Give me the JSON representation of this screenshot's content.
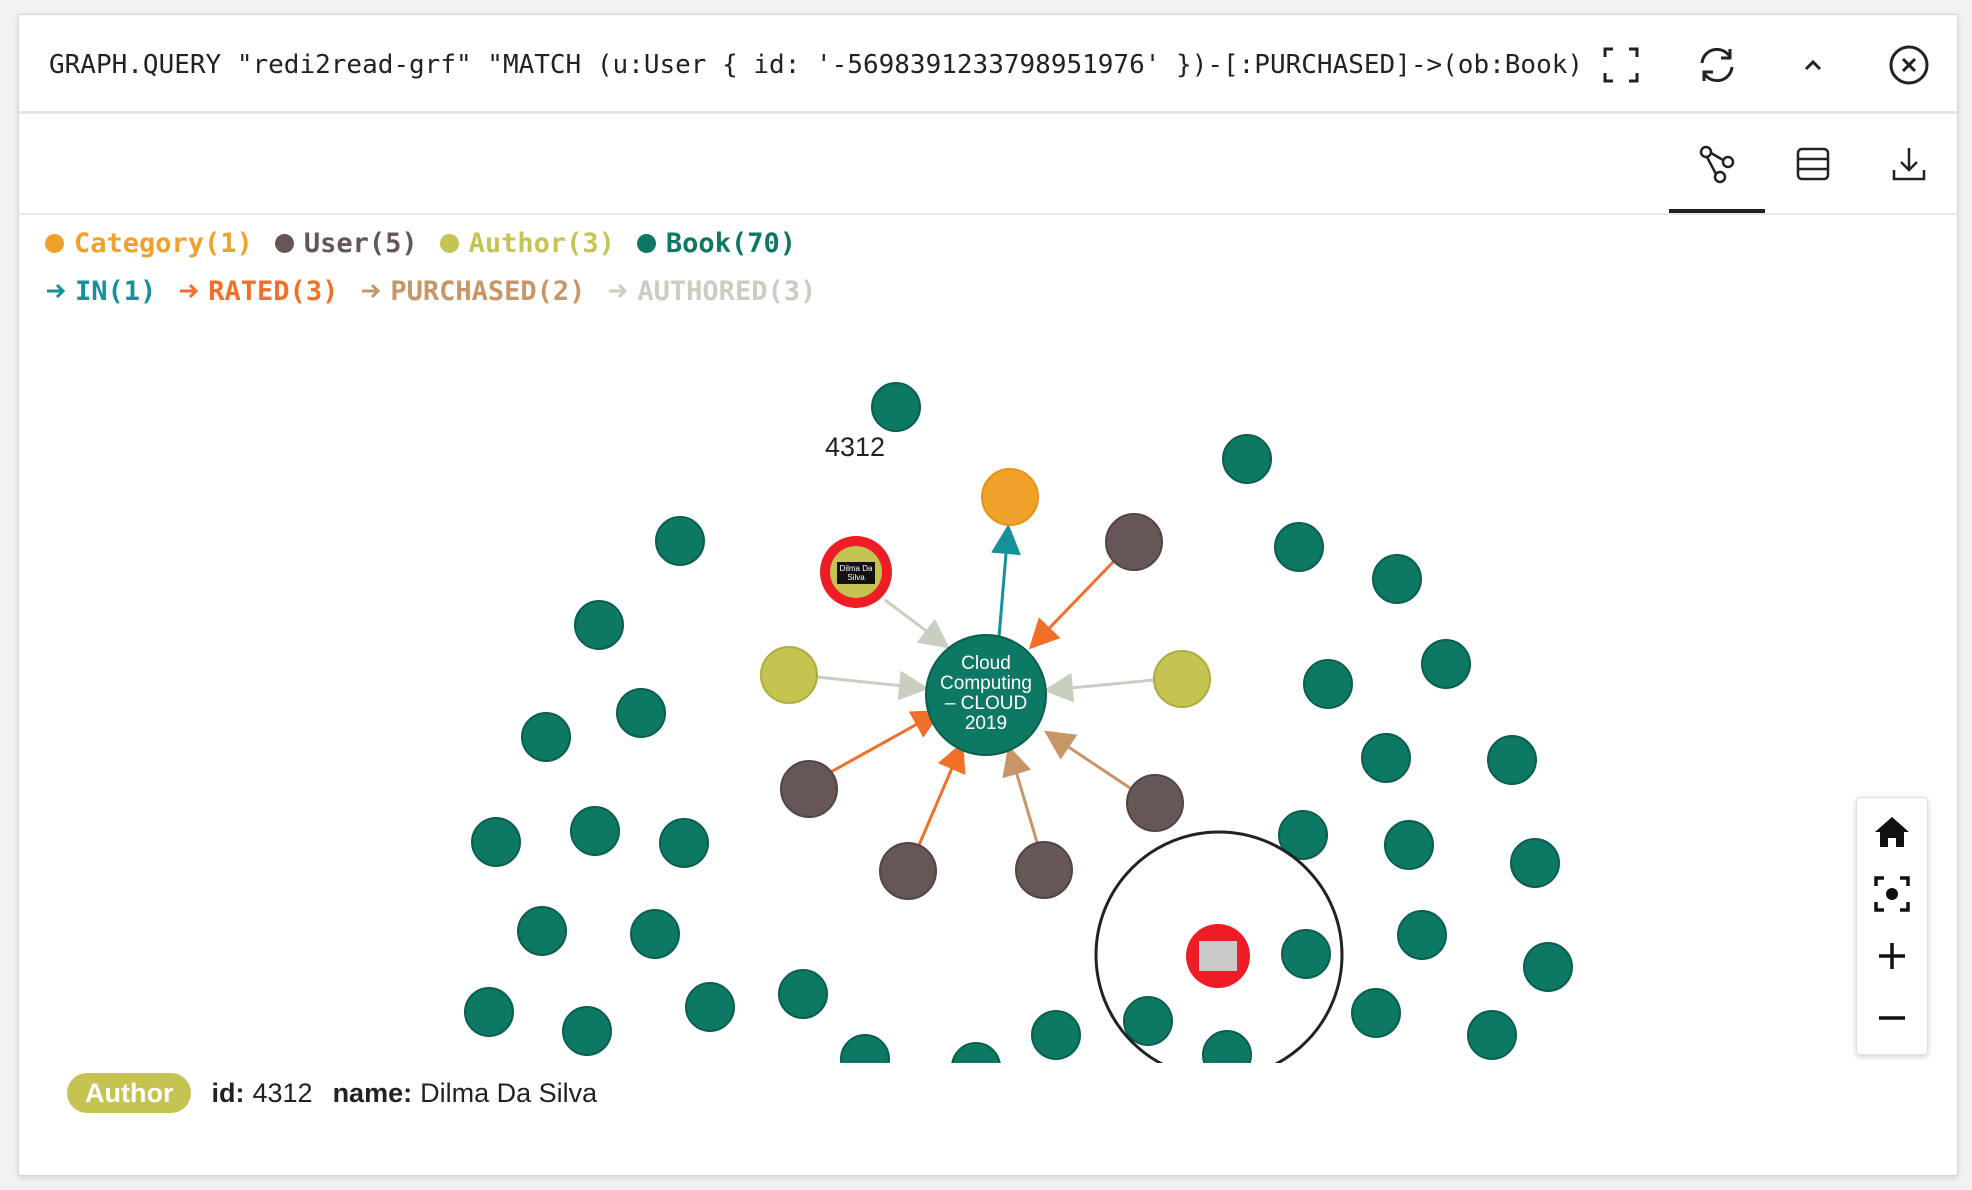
{
  "query": {
    "text": "GRAPH.QUERY \"redi2read-grf\" \"MATCH (u:User { id: '-5698391233798951976' })-[:PURCHASED]->(ob:Book)",
    "fullscreen_icon": "fullscreen-icon",
    "refresh_icon": "refresh-icon",
    "collapse_icon": "chevron-up-icon",
    "close_icon": "close-circle-icon"
  },
  "toolbar": {
    "graph_view_icon": "graph-view-icon",
    "table_view_icon": "table-view-icon",
    "download_icon": "download-icon"
  },
  "legend": {
    "nodes": [
      {
        "label": "Category(1)",
        "color": "#f0a12a"
      },
      {
        "label": "User(5)",
        "color": "#665657"
      },
      {
        "label": "Author(3)",
        "color": "#c5c352"
      },
      {
        "label": "Book(70)",
        "color": "#0d7863"
      }
    ],
    "relationships": [
      {
        "label": "IN(1)",
        "color": "#14919b"
      },
      {
        "label": "RATED(3)",
        "color": "#f26f2a"
      },
      {
        "label": "PURCHASED(2)",
        "color": "#c79566"
      },
      {
        "label": "AUTHORED(3)",
        "color": "#c8cfc0"
      }
    ]
  },
  "graph": {
    "center_label_lines": [
      "Cloud",
      "Computing",
      "– CLOUD",
      "2019"
    ],
    "hover_id": "4312",
    "selected_node_thumb_lines": [
      "Dilma Da",
      "Silva"
    ],
    "colors": {
      "book": "#0d7863",
      "user": "#665657",
      "author": "#c5c352",
      "category": "#f0a12a",
      "selected_ring": "#ee1c25"
    }
  },
  "zoom": {
    "home_icon": "home-icon",
    "center_icon": "focus-center-icon",
    "zoom_in_icon": "zoom-in-icon",
    "zoom_out_icon": "zoom-out-icon"
  },
  "details": {
    "badge": "Author",
    "id_key": "id:",
    "id_value": "4312",
    "name_key": "name:",
    "name_value": "Dilma Da Silva"
  }
}
